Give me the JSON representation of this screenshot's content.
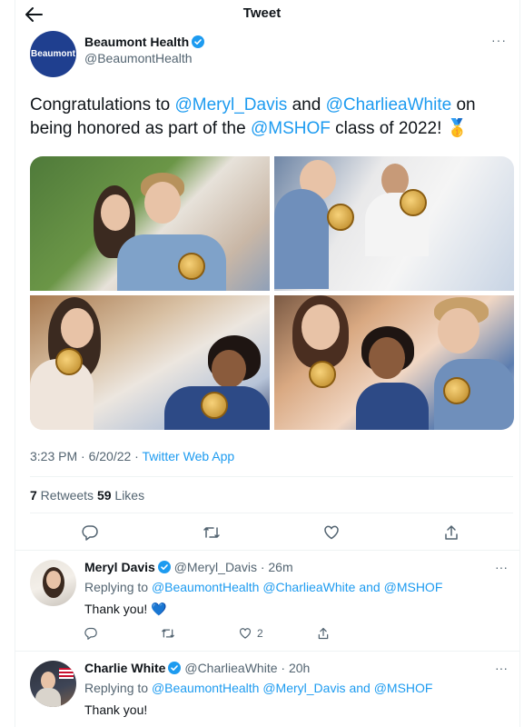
{
  "header": {
    "title": "Tweet"
  },
  "tweet": {
    "author_avatar_text": "Beaumont",
    "author_name": "Beaumont Health",
    "author_handle": "@BeaumontHealth",
    "more_label": "···",
    "text": {
      "part1": "Congratulations to ",
      "mention1": "@Meryl_Davis",
      "part2": " and ",
      "mention2": "@CharlieaWhite",
      "part3": " on being honored as part of the ",
      "mention3": "@MSHOF",
      "part4": " class of 2022! ",
      "emoji": "🥇"
    },
    "time": "3:23 PM · 6/20/22 · ",
    "source": "Twitter Web App",
    "retweets_count": "7",
    "retweets_label": " Retweets  ",
    "likes_count": "59",
    "likes_label": " Likes"
  },
  "replies": [
    {
      "name": "Meryl Davis",
      "handle": "@Meryl_Davis",
      "time": "· 26m",
      "replying_prefix": "Replying to ",
      "replying_to": "@BeaumontHealth @CharlieaWhite and @MSHOF",
      "text": "Thank you! ",
      "emoji": "💙",
      "like_count": "2",
      "more_label": "···"
    },
    {
      "name": "Charlie White",
      "handle": "@CharlieaWhite",
      "time": "· 20h",
      "replying_prefix": "Replying to ",
      "replying_to": "@BeaumontHealth @Meryl_Davis and @MSHOF",
      "text": "Thank you!",
      "more_label": "···"
    }
  ],
  "colors": {
    "accent": "#1d9bf0",
    "brand": "#1f3f8f",
    "muted": "#536471"
  },
  "icons": [
    "back-arrow-icon",
    "verified-icon",
    "reply-icon",
    "retweet-icon",
    "like-icon",
    "share-icon"
  ]
}
